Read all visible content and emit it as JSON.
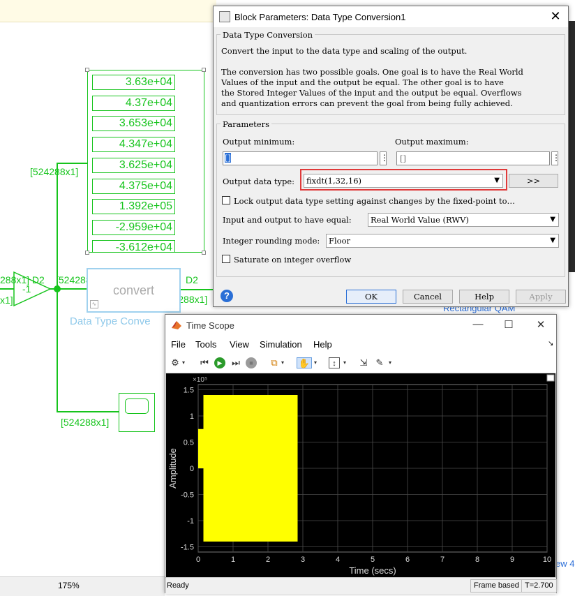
{
  "canvas": {
    "display_values": [
      "3.63e+04",
      "4.37e+04",
      "3.653e+04",
      "4.347e+04",
      "3.625e+04",
      "4.375e+04",
      "1.392e+05",
      "-2.959e+04",
      "-3.612e+04"
    ],
    "signal_label_top": "[524288x1]",
    "signal_label_left": "288x1] D2",
    "signal_label_left2": "x1]",
    "gain_value": "-1",
    "signal_label_mid": "[524288x1] D2",
    "signal_label_out_d2": "D2",
    "signal_label_out": "[524288x1]",
    "signal_label_bottom": "[524288x1]",
    "convert_text": "convert",
    "convert_block_name": "Data Type Conve",
    "bg_label_rectangular": "Rectangular QAM",
    "bg_label_view": "ew 4",
    "zoom": "175%",
    "colors": {
      "signal": "#16c41c",
      "selected": "#8fc9ea"
    }
  },
  "dialog": {
    "title": "Block Parameters: Data Type Conversion1",
    "group_title": "Data Type Conversion",
    "desc1": "Convert the input to the data type and scaling of the output.",
    "desc2_lines": [
      "The conversion has two possible goals. One goal is to have the Real World",
      "Values of the input and the output be equal.  The other goal is to have",
      "the Stored Integer Values of the input and the output be equal.  Overflows",
      "and quantization errors can prevent the goal from being fully achieved."
    ],
    "params_title": "Parameters",
    "output_min_label": "Output minimum:",
    "output_min_value": "[]",
    "output_max_label": "Output maximum:",
    "output_max_value": "[]",
    "dots": "⋮",
    "output_type_label": "Output data type:",
    "output_type_value": "fixdt(1,32,16)",
    "assistant_button": ">>",
    "lock_label": "Lock output data type setting against changes by the fixed-point to…",
    "io_equal_label": "Input and output to have equal:",
    "io_equal_value": "Real World Value (RWV)",
    "rounding_label": "Integer rounding mode:",
    "rounding_value": "Floor",
    "saturate_label": "Saturate on integer overflow",
    "buttons": {
      "ok": "OK",
      "cancel": "Cancel",
      "help": "Help",
      "apply": "Apply"
    },
    "highlight_color": "#e03a3a"
  },
  "scope": {
    "title": "Time Scope",
    "menu": [
      "File",
      "Tools",
      "View",
      "Simulation",
      "Help"
    ],
    "icons": [
      "gear-icon",
      "rewind-icon",
      "run-icon",
      "step-forward-icon",
      "stop-icon",
      "highlight-icon",
      "pan-hand-icon",
      "zoom-axes-icon",
      "cursor-icon",
      "style-brush-icon"
    ],
    "exponent_label": "×10⁵",
    "ylabel": "Amplitude",
    "xlabel": "Time (secs)",
    "status_ready": "Ready",
    "status_mode": "Frame based",
    "status_time": "T=2.700"
  },
  "chart_data": {
    "type": "line",
    "xlabel": "Time (secs)",
    "ylabel": "Amplitude",
    "xlim": [
      0,
      10
    ],
    "ylim": [
      -1.6,
      1.6
    ],
    "y_scale_note": "×10⁵",
    "xticks": [
      0,
      1,
      2,
      3,
      4,
      5,
      6,
      7,
      8,
      9,
      10
    ],
    "yticks": [
      -1.5,
      -1,
      -0.5,
      0,
      0.5,
      1,
      1.5
    ],
    "grid": true,
    "background": "#000000",
    "series": [
      {
        "color": "#ffff00",
        "segments": [
          {
            "x": [
              0,
              0.15
            ],
            "ymin": 0,
            "ymax": 0.75
          },
          {
            "x": [
              0.15,
              2.85
            ],
            "ymin": -1.4,
            "ymax": 1.4
          }
        ]
      }
    ]
  }
}
